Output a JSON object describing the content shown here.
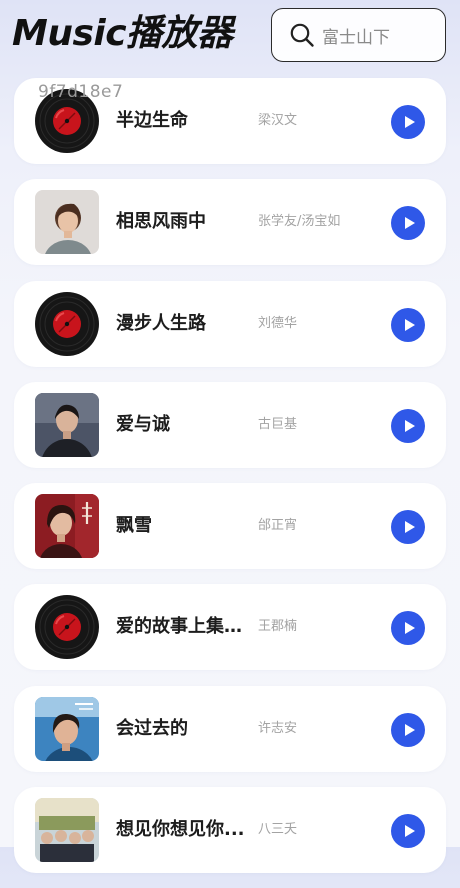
{
  "header": {
    "title": "Music播放器",
    "search_placeholder": "富士山下"
  },
  "watermark": "9f7d18e7",
  "songs": [
    {
      "title": "半边生命",
      "artist": "梁汉文",
      "cover": "vinyl"
    },
    {
      "title": "相思风雨中",
      "artist": "张学友/汤宝如",
      "cover": "photo-woman"
    },
    {
      "title": "漫步人生路",
      "artist": "刘德华",
      "cover": "vinyl"
    },
    {
      "title": "爱与诚",
      "artist": "古巨基",
      "cover": "photo-man-dark"
    },
    {
      "title": "飘雪",
      "artist": "邰正宵",
      "cover": "photo-album-red"
    },
    {
      "title": "爱的故事上集(...",
      "artist": "王郡楠",
      "cover": "vinyl"
    },
    {
      "title": "会过去的",
      "artist": "许志安",
      "cover": "photo-album-blue"
    },
    {
      "title": "想见你想见你...",
      "artist": "八三夭",
      "cover": "photo-group"
    }
  ],
  "colors": {
    "accent": "#2f58e8",
    "vinyl_label": "#c8141c"
  }
}
